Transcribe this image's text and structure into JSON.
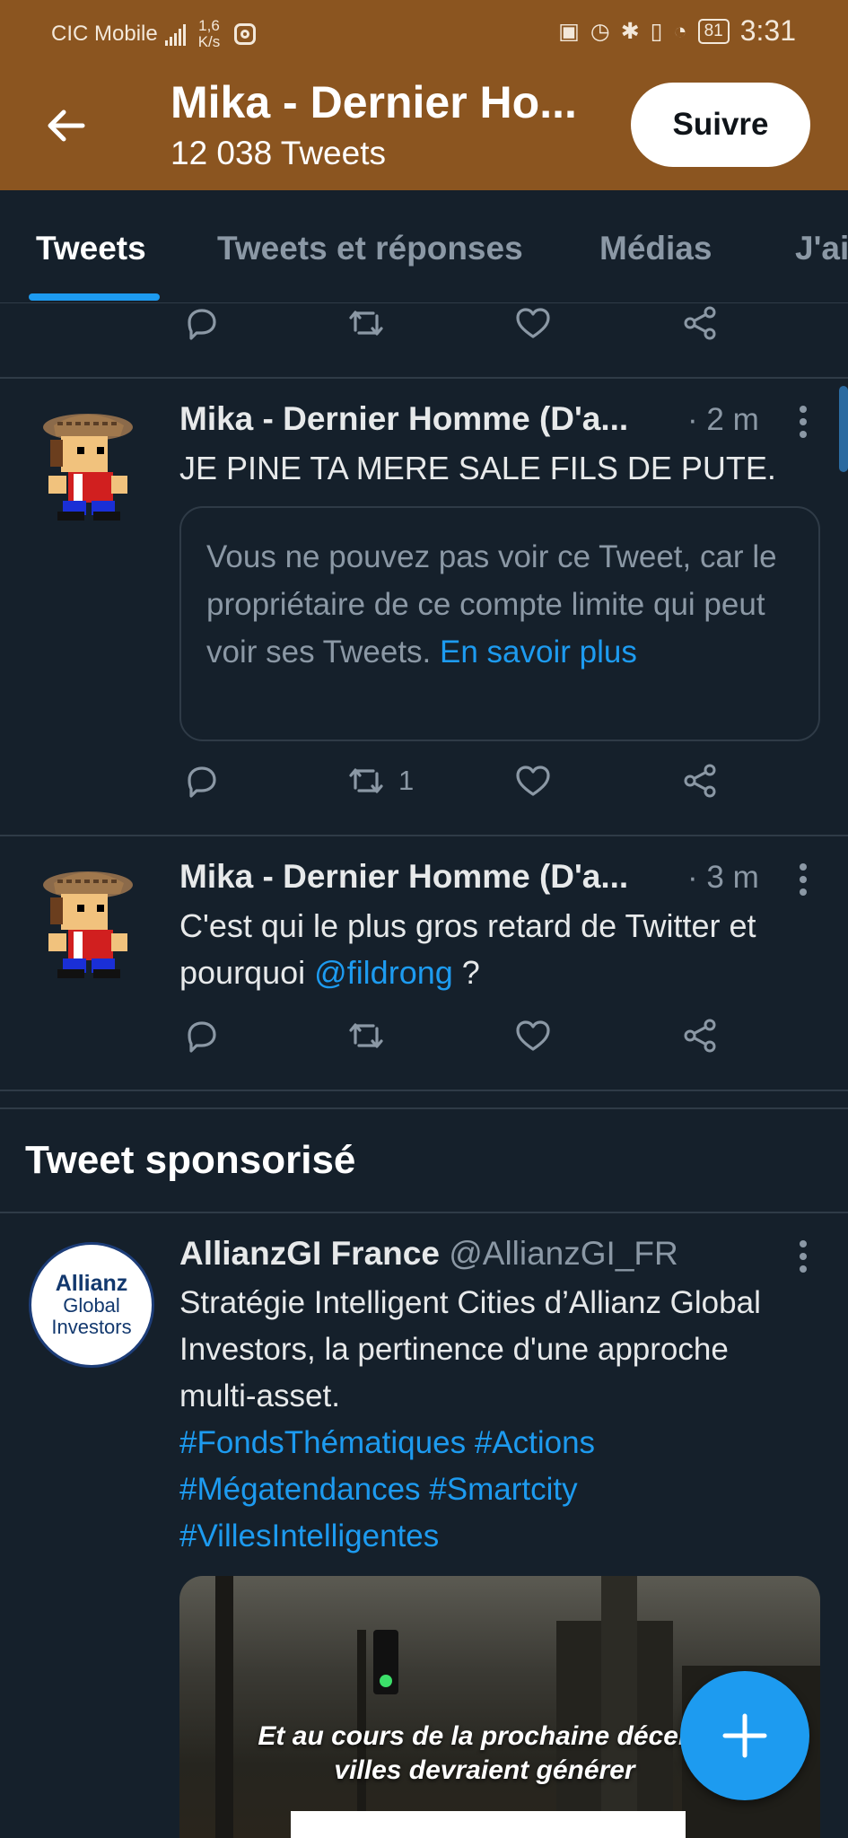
{
  "status_bar": {
    "carrier": "CIC Mobile",
    "network": "4G⁺",
    "speed_top": "1,6",
    "speed_bottom": "K/s",
    "battery": "81",
    "time": "3:31"
  },
  "header": {
    "title": "Mika - Dernier Homme (D'avoir des…",
    "title_short": "Mika - Dernier Ho...",
    "tweet_count": "12 038 Tweets",
    "follow_label": "Suivre",
    "bg_color": "#8b5520"
  },
  "tabs": [
    {
      "label": "Tweets",
      "active": true
    },
    {
      "label": "Tweets et réponses",
      "active": false
    },
    {
      "label": "Médias",
      "active": false
    },
    {
      "label": "J'ai",
      "active": false
    }
  ],
  "tweets": [
    {
      "name": "Mika - Dernier Homme (D'a...",
      "time": "· 2 m",
      "text": "JE PINE TA MERE SALE FILS DE PUTE.",
      "withheld_text": "Vous ne pouvez pas voir ce Tweet, car le propriétaire de ce compte limite qui peut voir ses Tweets.",
      "withheld_link": "En savoir plus",
      "retweets": "1"
    },
    {
      "name": "Mika - Dernier Homme (D'a...",
      "time": "· 3 m",
      "text_before": "C'est qui le plus gros retard de Twitter et pourquoi",
      "mention": "@fildrong",
      "text_after": " ?"
    }
  ],
  "sponsored": {
    "section_title": "Tweet sponsorisé",
    "name": "AllianzGI France",
    "handle": "@AllianzGI_FR",
    "text": "Stratégie Intelligent Cities d’Allianz Global Investors, la pertinence d'une approche multi-asset.",
    "hashtags": [
      "#FondsThématiques",
      "#Actions",
      "#Mégatendances",
      "#Smartcity",
      "#VillesIntelligentes"
    ],
    "avatar_line1": "Allianz",
    "avatar_line2": "Global",
    "avatar_line3": "Investors",
    "media_caption_line1": "Et au cours de la prochaine décenn",
    "media_caption_line2": "villes devraient générer"
  },
  "colors": {
    "background": "#15202b",
    "accent": "#1d9bf0",
    "muted": "#8b98a5"
  },
  "icons": [
    "back-arrow-icon",
    "reply-icon",
    "retweet-icon",
    "like-icon",
    "share-icon",
    "more-icon",
    "compose-icon"
  ]
}
